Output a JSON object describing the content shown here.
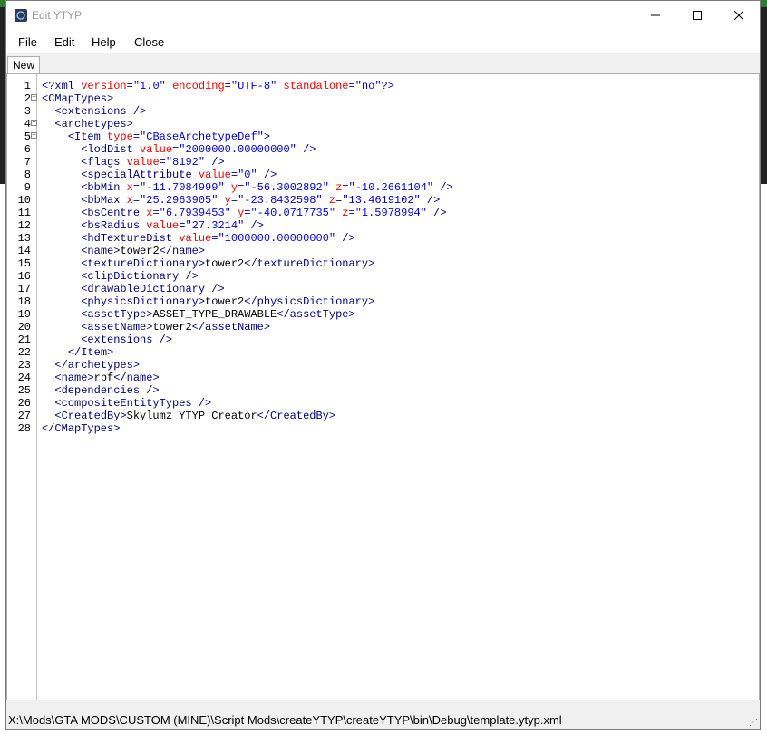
{
  "window": {
    "title": "Edit YTYP",
    "controls": {
      "minimize": "—",
      "maximize": "☐",
      "close": "✕"
    }
  },
  "menu": [
    "File",
    "Edit",
    "Help",
    "Close"
  ],
  "tab": {
    "label": "New"
  },
  "editor": {
    "lines": [
      {
        "n": "1",
        "fold": "",
        "indent": 0,
        "tokens": [
          [
            "tag",
            "<?xml "
          ],
          [
            "attr",
            "version"
          ],
          [
            "tag",
            "="
          ],
          [
            "val",
            "\"1.0\""
          ],
          [
            "tag",
            " "
          ],
          [
            "attr",
            "encoding"
          ],
          [
            "tag",
            "="
          ],
          [
            "val",
            "\"UTF-8\""
          ],
          [
            "tag",
            " "
          ],
          [
            "attr",
            "standalone"
          ],
          [
            "tag",
            "="
          ],
          [
            "val",
            "\"no\""
          ],
          [
            "tag",
            "?>"
          ]
        ]
      },
      {
        "n": "2",
        "fold": "−",
        "indent": 0,
        "tokens": [
          [
            "tag",
            "<CMapTypes>"
          ]
        ]
      },
      {
        "n": "3",
        "fold": "",
        "indent": 2,
        "tokens": [
          [
            "tag",
            "<extensions />"
          ]
        ]
      },
      {
        "n": "4",
        "fold": "−",
        "indent": 2,
        "tokens": [
          [
            "tag",
            "<archetypes>"
          ]
        ]
      },
      {
        "n": "5",
        "fold": "−",
        "indent": 4,
        "tokens": [
          [
            "tag",
            "<Item "
          ],
          [
            "attr",
            "type"
          ],
          [
            "tag",
            "="
          ],
          [
            "val",
            "\"CBaseArchetypeDef\""
          ],
          [
            "tag",
            ">"
          ]
        ]
      },
      {
        "n": "6",
        "fold": "",
        "indent": 6,
        "tokens": [
          [
            "tag",
            "<lodDist "
          ],
          [
            "attr",
            "value"
          ],
          [
            "tag",
            "="
          ],
          [
            "val",
            "\"2000000.00000000\""
          ],
          [
            "tag",
            " />"
          ]
        ]
      },
      {
        "n": "7",
        "fold": "",
        "indent": 6,
        "tokens": [
          [
            "tag",
            "<flags "
          ],
          [
            "attr",
            "value"
          ],
          [
            "tag",
            "="
          ],
          [
            "val",
            "\"8192\""
          ],
          [
            "tag",
            " />"
          ]
        ]
      },
      {
        "n": "8",
        "fold": "",
        "indent": 6,
        "tokens": [
          [
            "tag",
            "<specialAttribute "
          ],
          [
            "attr",
            "value"
          ],
          [
            "tag",
            "="
          ],
          [
            "val",
            "\"0\""
          ],
          [
            "tag",
            " />"
          ]
        ]
      },
      {
        "n": "9",
        "fold": "",
        "indent": 6,
        "tokens": [
          [
            "tag",
            "<bbMin "
          ],
          [
            "attr",
            "x"
          ],
          [
            "tag",
            "="
          ],
          [
            "val",
            "\"-11.7084999\""
          ],
          [
            "tag",
            " "
          ],
          [
            "attr",
            "y"
          ],
          [
            "tag",
            "="
          ],
          [
            "val",
            "\"-56.3002892\""
          ],
          [
            "tag",
            " "
          ],
          [
            "attr",
            "z"
          ],
          [
            "tag",
            "="
          ],
          [
            "val",
            "\"-10.2661104\""
          ],
          [
            "tag",
            " />"
          ]
        ]
      },
      {
        "n": "10",
        "fold": "",
        "indent": 6,
        "tokens": [
          [
            "tag",
            "<bbMax "
          ],
          [
            "attr",
            "x"
          ],
          [
            "tag",
            "="
          ],
          [
            "val",
            "\"25.2963905\""
          ],
          [
            "tag",
            " "
          ],
          [
            "attr",
            "y"
          ],
          [
            "tag",
            "="
          ],
          [
            "val",
            "\"-23.8432598\""
          ],
          [
            "tag",
            " "
          ],
          [
            "attr",
            "z"
          ],
          [
            "tag",
            "="
          ],
          [
            "val",
            "\"13.4619102\""
          ],
          [
            "tag",
            " />"
          ]
        ]
      },
      {
        "n": "11",
        "fold": "",
        "indent": 6,
        "tokens": [
          [
            "tag",
            "<bsCentre "
          ],
          [
            "attr",
            "x"
          ],
          [
            "tag",
            "="
          ],
          [
            "val",
            "\"6.7939453\""
          ],
          [
            "tag",
            " "
          ],
          [
            "attr",
            "y"
          ],
          [
            "tag",
            "="
          ],
          [
            "val",
            "\"-40.0717735\""
          ],
          [
            "tag",
            " "
          ],
          [
            "attr",
            "z"
          ],
          [
            "tag",
            "="
          ],
          [
            "val",
            "\"1.5978994\""
          ],
          [
            "tag",
            " />"
          ]
        ]
      },
      {
        "n": "12",
        "fold": "",
        "indent": 6,
        "tokens": [
          [
            "tag",
            "<bsRadius "
          ],
          [
            "attr",
            "value"
          ],
          [
            "tag",
            "="
          ],
          [
            "val",
            "\"27.3214\""
          ],
          [
            "tag",
            " />"
          ]
        ]
      },
      {
        "n": "13",
        "fold": "",
        "indent": 6,
        "tokens": [
          [
            "tag",
            "<hdTextureDist "
          ],
          [
            "attr",
            "value"
          ],
          [
            "tag",
            "="
          ],
          [
            "val",
            "\"1000000.00000000\""
          ],
          [
            "tag",
            " />"
          ]
        ]
      },
      {
        "n": "14",
        "fold": "",
        "indent": 6,
        "tokens": [
          [
            "tag",
            "<name>"
          ],
          [
            "txt",
            "tower2"
          ],
          [
            "tag",
            "</name>"
          ]
        ]
      },
      {
        "n": "15",
        "fold": "",
        "indent": 6,
        "tokens": [
          [
            "tag",
            "<textureDictionary>"
          ],
          [
            "txt",
            "tower2"
          ],
          [
            "tag",
            "</textureDictionary>"
          ]
        ]
      },
      {
        "n": "16",
        "fold": "",
        "indent": 6,
        "tokens": [
          [
            "tag",
            "<clipDictionary />"
          ]
        ]
      },
      {
        "n": "17",
        "fold": "",
        "indent": 6,
        "tokens": [
          [
            "tag",
            "<drawableDictionary />"
          ]
        ]
      },
      {
        "n": "18",
        "fold": "",
        "indent": 6,
        "tokens": [
          [
            "tag",
            "<physicsDictionary>"
          ],
          [
            "txt",
            "tower2"
          ],
          [
            "tag",
            "</physicsDictionary>"
          ]
        ]
      },
      {
        "n": "19",
        "fold": "",
        "indent": 6,
        "tokens": [
          [
            "tag",
            "<assetType>"
          ],
          [
            "txt",
            "ASSET_TYPE_DRAWABLE"
          ],
          [
            "tag",
            "</assetType>"
          ]
        ]
      },
      {
        "n": "20",
        "fold": "",
        "indent": 6,
        "tokens": [
          [
            "tag",
            "<assetName>"
          ],
          [
            "txt",
            "tower2"
          ],
          [
            "tag",
            "</assetName>"
          ]
        ]
      },
      {
        "n": "21",
        "fold": "",
        "indent": 6,
        "tokens": [
          [
            "tag",
            "<extensions />"
          ]
        ]
      },
      {
        "n": "22",
        "fold": "",
        "indent": 4,
        "tokens": [
          [
            "tag",
            "</Item>"
          ]
        ]
      },
      {
        "n": "23",
        "fold": "",
        "indent": 2,
        "tokens": [
          [
            "tag",
            "</archetypes>"
          ]
        ]
      },
      {
        "n": "24",
        "fold": "",
        "indent": 2,
        "tokens": [
          [
            "tag",
            "<name>"
          ],
          [
            "txt",
            "rpf"
          ],
          [
            "tag",
            "</name>"
          ]
        ]
      },
      {
        "n": "25",
        "fold": "",
        "indent": 2,
        "tokens": [
          [
            "tag",
            "<dependencies />"
          ]
        ]
      },
      {
        "n": "26",
        "fold": "",
        "indent": 2,
        "tokens": [
          [
            "tag",
            "<compositeEntityTypes />"
          ]
        ]
      },
      {
        "n": "27",
        "fold": "",
        "indent": 2,
        "tokens": [
          [
            "tag",
            "<CreatedBy>"
          ],
          [
            "txt",
            "Skylumz YTYP Creator"
          ],
          [
            "tag",
            "</CreatedBy>"
          ]
        ]
      },
      {
        "n": "28",
        "fold": "",
        "indent": 0,
        "tokens": [
          [
            "tag",
            "</CMapTypes>"
          ]
        ]
      }
    ]
  },
  "status": {
    "path": "X:\\Mods\\GTA MODS\\CUSTOM (MINE)\\Script Mods\\createYTYP\\createYTYP\\bin\\Debug\\template.ytyp.xml"
  },
  "colors": {
    "tag": "#00008b",
    "attr": "#ff0000",
    "value": "#0000ff",
    "text": "#000000"
  }
}
